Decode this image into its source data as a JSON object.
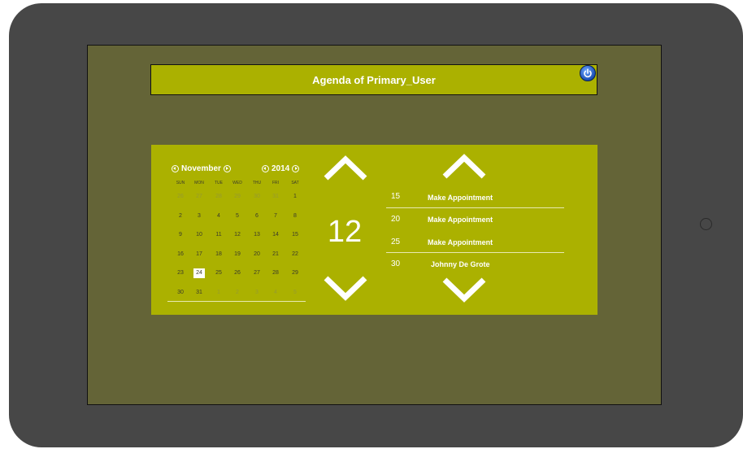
{
  "header": {
    "title": "Agenda of Primary_User",
    "power_icon": "power-icon"
  },
  "calendar": {
    "month": "November",
    "year": "2014",
    "weekdays": [
      "SUN",
      "MON",
      "TUE",
      "WED",
      "THU",
      "FRI",
      "SAT"
    ],
    "weeks": [
      [
        {
          "d": "26",
          "m": true
        },
        {
          "d": "27",
          "m": true
        },
        {
          "d": "28",
          "m": true
        },
        {
          "d": "29",
          "m": true
        },
        {
          "d": "30",
          "m": true
        },
        {
          "d": "31",
          "m": true
        },
        {
          "d": "1"
        }
      ],
      [
        {
          "d": "2"
        },
        {
          "d": "3"
        },
        {
          "d": "4"
        },
        {
          "d": "5"
        },
        {
          "d": "6"
        },
        {
          "d": "7"
        },
        {
          "d": "8"
        }
      ],
      [
        {
          "d": "9"
        },
        {
          "d": "10"
        },
        {
          "d": "11"
        },
        {
          "d": "12"
        },
        {
          "d": "13"
        },
        {
          "d": "14"
        },
        {
          "d": "15"
        }
      ],
      [
        {
          "d": "16"
        },
        {
          "d": "17"
        },
        {
          "d": "18"
        },
        {
          "d": "19"
        },
        {
          "d": "20"
        },
        {
          "d": "21"
        },
        {
          "d": "22"
        }
      ],
      [
        {
          "d": "23"
        },
        {
          "d": "24",
          "s": true
        },
        {
          "d": "25"
        },
        {
          "d": "26"
        },
        {
          "d": "27"
        },
        {
          "d": "28"
        },
        {
          "d": "29"
        }
      ],
      [
        {
          "d": "30"
        },
        {
          "d": "31"
        },
        {
          "d": "1",
          "m": true
        },
        {
          "d": "2",
          "m": true
        },
        {
          "d": "3",
          "m": true
        },
        {
          "d": "4",
          "m": true
        },
        {
          "d": "5",
          "m": true
        }
      ]
    ]
  },
  "hour": {
    "value": "12"
  },
  "appointments": [
    {
      "time": "15",
      "title": "Make Appointment"
    },
    {
      "time": "20",
      "title": "Make Appointment"
    },
    {
      "time": "25",
      "title": "Make Appointment"
    },
    {
      "time": "30",
      "title": "Johnny De Grote"
    }
  ],
  "colors": {
    "panel": "#abb100",
    "screen": "#646437",
    "device": "#474747"
  }
}
